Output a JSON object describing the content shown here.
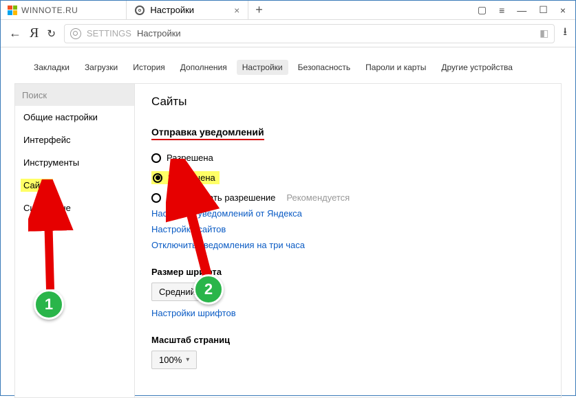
{
  "titlebar": {
    "caption": "WINNOTE.RU"
  },
  "tab": {
    "title": "Настройки"
  },
  "addr": {
    "prefix": "SETTINGS",
    "label": "Настройки"
  },
  "topnav": {
    "items": [
      "Закладки",
      "Загрузки",
      "История",
      "Дополнения",
      "Настройки",
      "Безопасность",
      "Пароли и карты",
      "Другие устройства"
    ],
    "active_index": 4
  },
  "sidebar": {
    "search_placeholder": "Поиск",
    "items": [
      "Общие настройки",
      "Интерфейс",
      "Инструменты",
      "Сайты",
      "Системные"
    ],
    "highlight_index": 3
  },
  "main": {
    "heading": "Сайты",
    "section_notify": "Отправка уведомлений",
    "radio_allowed": "Разрешена",
    "radio_denied": "Запрещена",
    "radio_ask": "Запрашивать разрешение",
    "recommended": "Рекомендуется",
    "link_yandex": "Настройки уведомлений от Яндекса",
    "link_sites": "Настройки сайтов",
    "link_snooze": "Отключить уведомления на три часа",
    "font_size_title": "Размер шрифта",
    "font_size_value": "Средний",
    "link_fonts": "Настройки шрифтов",
    "zoom_title": "Масштаб страниц",
    "zoom_value": "100%"
  },
  "annotations": {
    "bubble1": "1",
    "bubble2": "2"
  }
}
